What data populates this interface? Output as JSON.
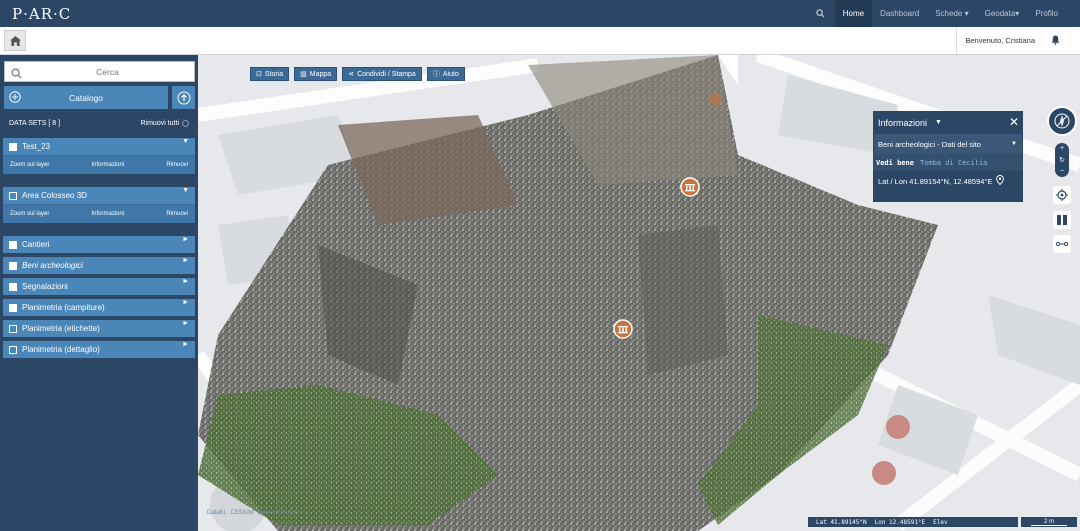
{
  "brand": {
    "logo_text": "P·AR·C"
  },
  "topnav": {
    "items": [
      {
        "label": "Home",
        "active": true
      },
      {
        "label": "Dashboard"
      },
      {
        "label": "Schede ▾"
      },
      {
        "label": "Geodata▾"
      },
      {
        "label": "Profilo"
      }
    ]
  },
  "subbar": {
    "welcome": "Benvenuto, Cristiana"
  },
  "sidebar": {
    "search_placeholder": "Cerca",
    "catalog_label": "Catalogo",
    "datasets_label": "DATA SETS  [ 8 ]",
    "remove_all_label": "Rimuovi tutti",
    "layers": [
      {
        "label": "Test_23",
        "checked": true,
        "expanded": true,
        "actions": [
          "Zoom sul layer",
          "Informazioni",
          "Rimuovi"
        ]
      },
      {
        "label": "Area Colosseo 3D",
        "checked": false,
        "expanded": true,
        "actions": [
          "Zoom sul layer",
          "Informazioni",
          "Rimuovi"
        ]
      },
      {
        "label": "Cantieri",
        "checked": true
      },
      {
        "label": "Beni archeologici",
        "checked": true,
        "italic": true
      },
      {
        "label": "Segnalazioni",
        "checked": true
      },
      {
        "label": "Planimetria (campiture)",
        "checked": true
      },
      {
        "label": "Planimetria (etichette)",
        "checked": false
      },
      {
        "label": "Planimetria (dettaglio)",
        "checked": false
      }
    ]
  },
  "map": {
    "toolbar": [
      {
        "label": "Storia"
      },
      {
        "label": "Mappa"
      },
      {
        "label": "Condividi / Stampa"
      },
      {
        "label": "Aiuto"
      }
    ],
    "attribution": [
      "Data61",
      "CESIUM",
      "Data attribution"
    ],
    "status": {
      "lat": "Lat  41.89145°N",
      "lon": "Lon  12.48591°E",
      "elev": "Elev"
    },
    "scale": "2 m"
  },
  "info_panel": {
    "title": "Informazioni",
    "selected_layer": "Beni archeologici - Dati del sito",
    "vedi_label": "Vedi bene",
    "vedi_link": "Tomba di Cecilia",
    "coords": "Lat / Lon 41.89154°N, 12.48594°E"
  },
  "colors": {
    "header": "#2c4766",
    "accent": "#4a86b8",
    "marker": "#c8743a"
  }
}
